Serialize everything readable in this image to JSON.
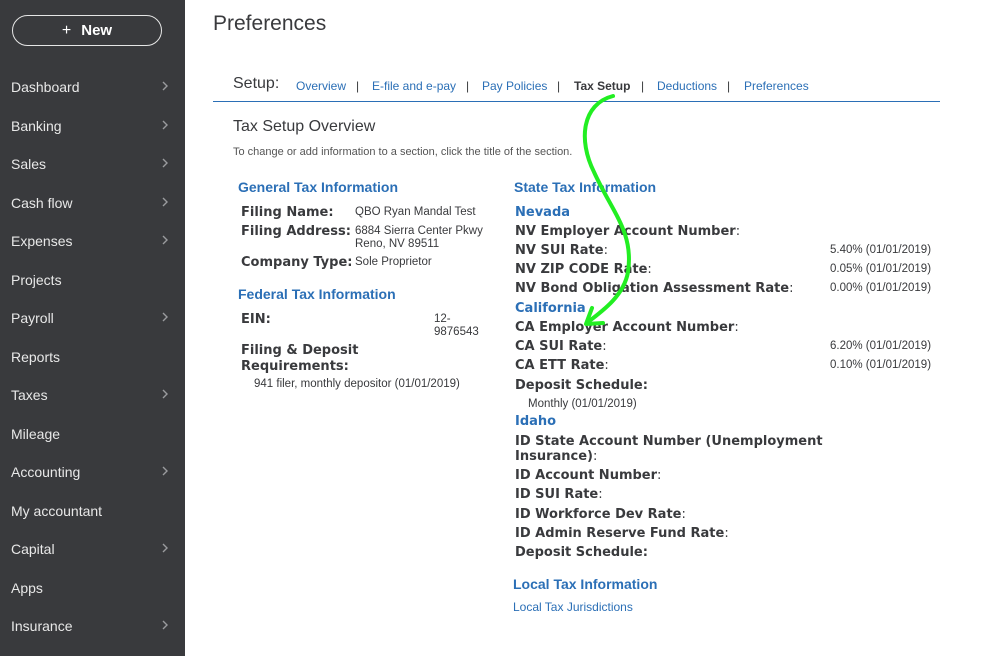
{
  "sidebar": {
    "new_button": {
      "icon": "plus-icon",
      "plus": "+",
      "label": "New"
    },
    "items": [
      {
        "label": "Dashboard",
        "chevron": true
      },
      {
        "label": "Banking",
        "chevron": true
      },
      {
        "label": "Sales",
        "chevron": true
      },
      {
        "label": "Cash flow",
        "chevron": true
      },
      {
        "label": "Expenses",
        "chevron": true
      },
      {
        "label": "Projects",
        "chevron": false
      },
      {
        "label": "Payroll",
        "chevron": true
      },
      {
        "label": "Reports",
        "chevron": false
      },
      {
        "label": "Taxes",
        "chevron": true
      },
      {
        "label": "Mileage",
        "chevron": false
      },
      {
        "label": "Accounting",
        "chevron": true
      },
      {
        "label": "My accountant",
        "chevron": false
      },
      {
        "label": "Capital",
        "chevron": true
      },
      {
        "label": "Apps",
        "chevron": false
      },
      {
        "label": "Insurance",
        "chevron": true
      }
    ]
  },
  "page_title": "Preferences",
  "setup": {
    "label": "Setup:",
    "tabs": [
      "Overview",
      "E-file and e-pay",
      "Pay Policies",
      "Tax Setup",
      "Deductions",
      "Preferences"
    ],
    "active_tab": "Tax Setup",
    "separator": "|"
  },
  "overview": {
    "title": "Tax Setup Overview",
    "instructions": "To change or add information to a section, click the title of the section."
  },
  "general": {
    "heading": "General Tax Information",
    "filing_name_label": "Filing Name:",
    "filing_name": "QBO Ryan Mandal Test",
    "filing_address_label": "Filing Address:",
    "address_line1": "6884 Sierra Center Pkwy",
    "address_line2": "Reno, NV 89511",
    "company_type_label": "Company Type:",
    "company_type": "Sole Proprietor"
  },
  "federal": {
    "heading": "Federal Tax Information",
    "ein_label": "EIN:",
    "ein_line1": "12-",
    "ein_line2": "9876543",
    "filing_label_line1": "Filing & Deposit",
    "filing_label_line2": "Requirements:",
    "filing_value": "941 filer, monthly depositor (01/01/2019)"
  },
  "state": {
    "heading": "State Tax Information",
    "nevada": {
      "name": "Nevada",
      "employer_acct_label": "NV Employer Account Number",
      "sui_label": "NV SUI Rate",
      "sui_value": "5.40% (01/01/2019)",
      "zip_label": "NV ZIP CODE Rate",
      "zip_value": "0.05% (01/01/2019)",
      "bond_label": "NV Bond Obligation Assessment Rate",
      "bond_value": "0.00% (01/01/2019)"
    },
    "california": {
      "name": "California",
      "employer_acct_label": "CA Employer Account Number",
      "sui_label": "CA SUI Rate",
      "sui_value": "6.20% (01/01/2019)",
      "ett_label": "CA ETT Rate",
      "ett_value": "0.10% (01/01/2019)",
      "deposit_label": "Deposit Schedule:",
      "deposit_value": "Monthly (01/01/2019)"
    },
    "idaho": {
      "name": "Idaho",
      "state_acct_line1": "ID State Account Number (Unemployment",
      "state_acct_line2": "Insurance)",
      "acct_label": "ID Account Number",
      "sui_label": "ID SUI Rate",
      "workforce_label": "ID Workforce Dev Rate",
      "admin_label": "ID Admin Reserve Fund Rate",
      "deposit_label": "Deposit Schedule:"
    },
    "colon": ":"
  },
  "local": {
    "heading": "Local Tax Information",
    "link": "Local Tax Jurisdictions"
  },
  "annotation": {
    "color": "#22ee22"
  },
  "colors": {
    "sidebar": "#393a3d",
    "link": "#2b6fb6",
    "text": "#393a3d"
  }
}
